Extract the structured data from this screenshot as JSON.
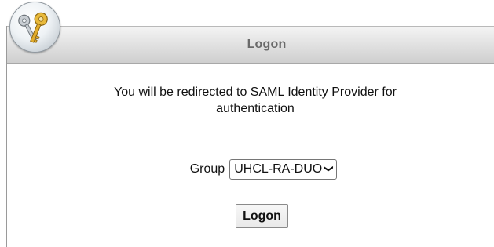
{
  "dialog": {
    "title": "Logon",
    "icon": "keys-icon"
  },
  "message": {
    "line1": "You will be redirected to SAML Identity Provider for",
    "line2": "authentication"
  },
  "group": {
    "label": "Group",
    "selected": "UHCL-RA-DUO"
  },
  "actions": {
    "logon_label": "Logon"
  }
}
